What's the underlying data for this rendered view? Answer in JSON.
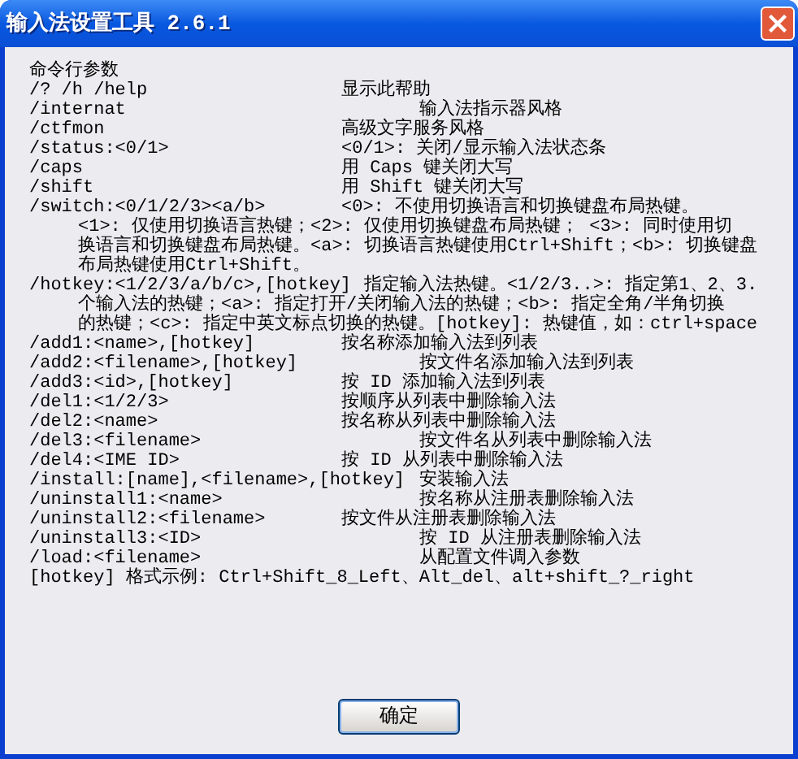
{
  "window": {
    "title": "输入法设置工具 2.6.1"
  },
  "help": {
    "heading": "命令行参数",
    "lines": [
      {
        "kind": "option",
        "command": "/? /h /help",
        "description": "显示此帮助"
      },
      {
        "kind": "offset",
        "command": "/internat",
        "description": "输入法指示器风格"
      },
      {
        "kind": "option",
        "command": "/ctfmon",
        "description": "高级文字服务风格"
      },
      {
        "kind": "option",
        "command": "/status:<0/1>",
        "description": "<0/1>: 关闭/显示输入法状态条"
      },
      {
        "kind": "option",
        "command": "/caps",
        "description": "用 Caps 键关闭大写"
      },
      {
        "kind": "option",
        "command": "/shift",
        "description": "用 Shift 键关闭大写"
      },
      {
        "kind": "option",
        "command": "/switch:<0/1/2/3><a/b>",
        "description": "<0>: 不使用切换语言和切换键盘布局热键。"
      },
      {
        "kind": "continuation",
        "text": "<1>: 仅使用切换语言热键；<2>: 仅使用切换键盘布局热键； <3>: 同时使用切"
      },
      {
        "kind": "continuation",
        "text": "换语言和切换键盘布局热键。<a>: 切换语言热键使用Ctrl+Shift；<b>: 切换键盘"
      },
      {
        "kind": "continuation",
        "text": "布局热键使用Ctrl+Shift。"
      },
      {
        "kind": "inline",
        "command": "/hotkey:<1/2/3/a/b/c>,[hotkey]",
        "description": "指定输入法热键。<1/2/3..>: 指定第1、2、3."
      },
      {
        "kind": "continuation",
        "text": "个输入法的热键；<a>: 指定打开/关闭输入法的热键；<b>: 指定全角/半角切换"
      },
      {
        "kind": "continuation",
        "text": "的热键；<c>: 指定中英文标点切换的热键。[hotkey]: 热键值，如：ctrl+space"
      },
      {
        "kind": "option",
        "command": "/add1:<name>,[hotkey]",
        "description": "按名称添加输入法到列表"
      },
      {
        "kind": "offset",
        "command": "/add2:<filename>,[hotkey]",
        "description": "按文件名添加输入法到列表"
      },
      {
        "kind": "option",
        "command": "/add3:<id>,[hotkey]",
        "description": "按 ID 添加输入法到列表"
      },
      {
        "kind": "option",
        "command": "/del1:<1/2/3>",
        "description": "按顺序从列表中删除输入法"
      },
      {
        "kind": "option",
        "command": "/del2:<name>",
        "description": "按名称从列表中删除输入法"
      },
      {
        "kind": "offset",
        "command": "/del3:<filename>",
        "description": "按文件名从列表中删除输入法"
      },
      {
        "kind": "option",
        "command": "/del4:<IME ID>",
        "description": "按 ID 从列表中删除输入法"
      },
      {
        "kind": "offset",
        "command": "/install:[name],<filename>,[hotkey]",
        "description": "安装输入法"
      },
      {
        "kind": "offset",
        "command": "/uninstall1:<name>",
        "description": "按名称从注册表删除输入法"
      },
      {
        "kind": "option",
        "command": "/uninstall2:<filename>",
        "description": "按文件从注册表删除输入法"
      },
      {
        "kind": "offset",
        "command": "/uninstall3:<ID>",
        "description": "按 ID 从注册表删除输入法"
      },
      {
        "kind": "offset",
        "command": "/load:<filename>",
        "description": "从配置文件调入参数"
      },
      {
        "kind": "note",
        "text": "[hotkey] 格式示例: Ctrl+Shift_8_Left、Alt_del、alt+shift_?_right"
      }
    ]
  },
  "buttons": [
    {
      "label": "确定"
    }
  ]
}
